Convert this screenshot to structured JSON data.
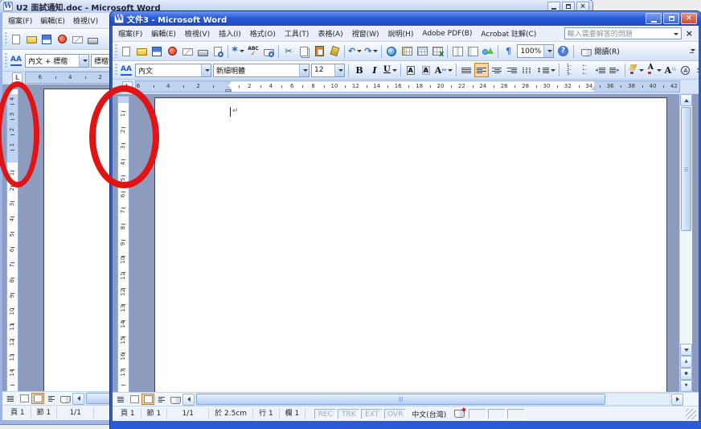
{
  "background_window": {
    "title": "U2 面試通知.doc - Microsoft Word",
    "menu": [
      "檔案(F)",
      "編輯(E)",
      "檢視(V)"
    ],
    "standard_toolbar": {
      "icons": [
        "new-document",
        "open",
        "save",
        "permission",
        "email",
        "print"
      ]
    },
    "formatting_toolbar": {
      "style_value": "內文 + 標楷",
      "font_value": "標楷體"
    },
    "h_ruler": {
      "margin_left": [
        6,
        4,
        2
      ],
      "body": [],
      "margin_right": []
    },
    "v_ruler": {
      "margin_numbers": [
        4,
        3,
        2,
        1
      ],
      "numbers": [
        1,
        2,
        3,
        4,
        5,
        6,
        7,
        8,
        9,
        10,
        11,
        12,
        13,
        14
      ]
    },
    "view_buttons": {
      "icons": [
        "normal-view",
        "web-layout-view",
        {
          "name": "print-layout-view",
          "active": true
        },
        "outline-view",
        "reading-view"
      ]
    },
    "status": {
      "page": "頁 1",
      "section": "節 1",
      "page_of": "1/1"
    }
  },
  "foreground_window": {
    "title": "文件3 - Microsoft Word",
    "menu": [
      "檔案(F)",
      "編輯(E)",
      "檢視(V)",
      "插入(I)",
      "格式(O)",
      "工具(T)",
      "表格(A)",
      "視窗(W)",
      "說明(H)",
      "Adobe PDF(B)",
      "Acrobat 註解(C)"
    ],
    "question_box": {
      "placeholder": "輸入需要解答的問題"
    },
    "standard_toolbar": {
      "icons": [
        "new-document",
        "open",
        "save",
        "permission",
        "email",
        "print",
        "print-preview",
        "sep",
        "research",
        "spelling-check",
        "reference-book",
        "sep",
        "cut",
        "copy",
        "paste",
        "format-painter",
        "sep",
        "undo",
        "redo",
        "sep",
        "insert-hyperlink",
        "tables-and-borders",
        "insert-table",
        "insert-excel",
        "sep",
        "columns",
        "document-map",
        "drawing",
        "sep",
        "show-hide-marks"
      ],
      "zoom_value": "100%",
      "icons2": [
        "help"
      ],
      "read_button_label": "閱讀(R)"
    },
    "formatting_toolbar": {
      "style_value": "內文",
      "font_value": "新細明體",
      "size_value": "12",
      "icons": [
        "bold",
        "italic",
        "underline",
        "sep",
        "character-border",
        "character-shading",
        "character-scaling",
        "sep",
        "justify",
        {
          "name": "align-left",
          "active": true
        },
        "align-center",
        "align-right",
        "distribute",
        "line-spacing",
        "sep",
        "numbering",
        "bullets",
        "decrease-indent",
        "increase-indent",
        "sep",
        "highlight",
        "font-color",
        "asian-layout",
        "enclosed-character"
      ]
    },
    "h_ruler": {
      "margin_left": [
        6,
        4,
        2
      ],
      "body": [
        2,
        4,
        6,
        8,
        10,
        12,
        14,
        16,
        18,
        20,
        22,
        24,
        26,
        28,
        30,
        32,
        34
      ],
      "margin_right": [
        36,
        38,
        40,
        42
      ]
    },
    "v_ruler": {
      "margin_numbers": [],
      "numbers": [
        1,
        2,
        3,
        4,
        5,
        6,
        7,
        8,
        9,
        10,
        11,
        12,
        13,
        14,
        15,
        16,
        17
      ]
    },
    "view_buttons": {
      "icons": [
        "normal-view",
        "web-layout-view",
        {
          "name": "print-layout-view",
          "active": true
        },
        "outline-view",
        "reading-view"
      ]
    },
    "status": {
      "page": "頁 1",
      "section": "節 1",
      "page_of": "1/1",
      "at": "於 2.5cm",
      "line": "行 1",
      "column": "欄 1",
      "rec": "REC",
      "trk": "TRK",
      "ext": "EXT",
      "ovr": "OVR",
      "language": "中文(台灣)"
    }
  },
  "colors": {
    "title_bar_active": "#2b5bd8",
    "title_bar_inactive": "#c5d6f2",
    "close_button": "#cf4a30",
    "toolbar_active_highlight": "#fbd6a2",
    "outside_page_background": "#8d9cbe",
    "annotation_red": "#e01414"
  }
}
